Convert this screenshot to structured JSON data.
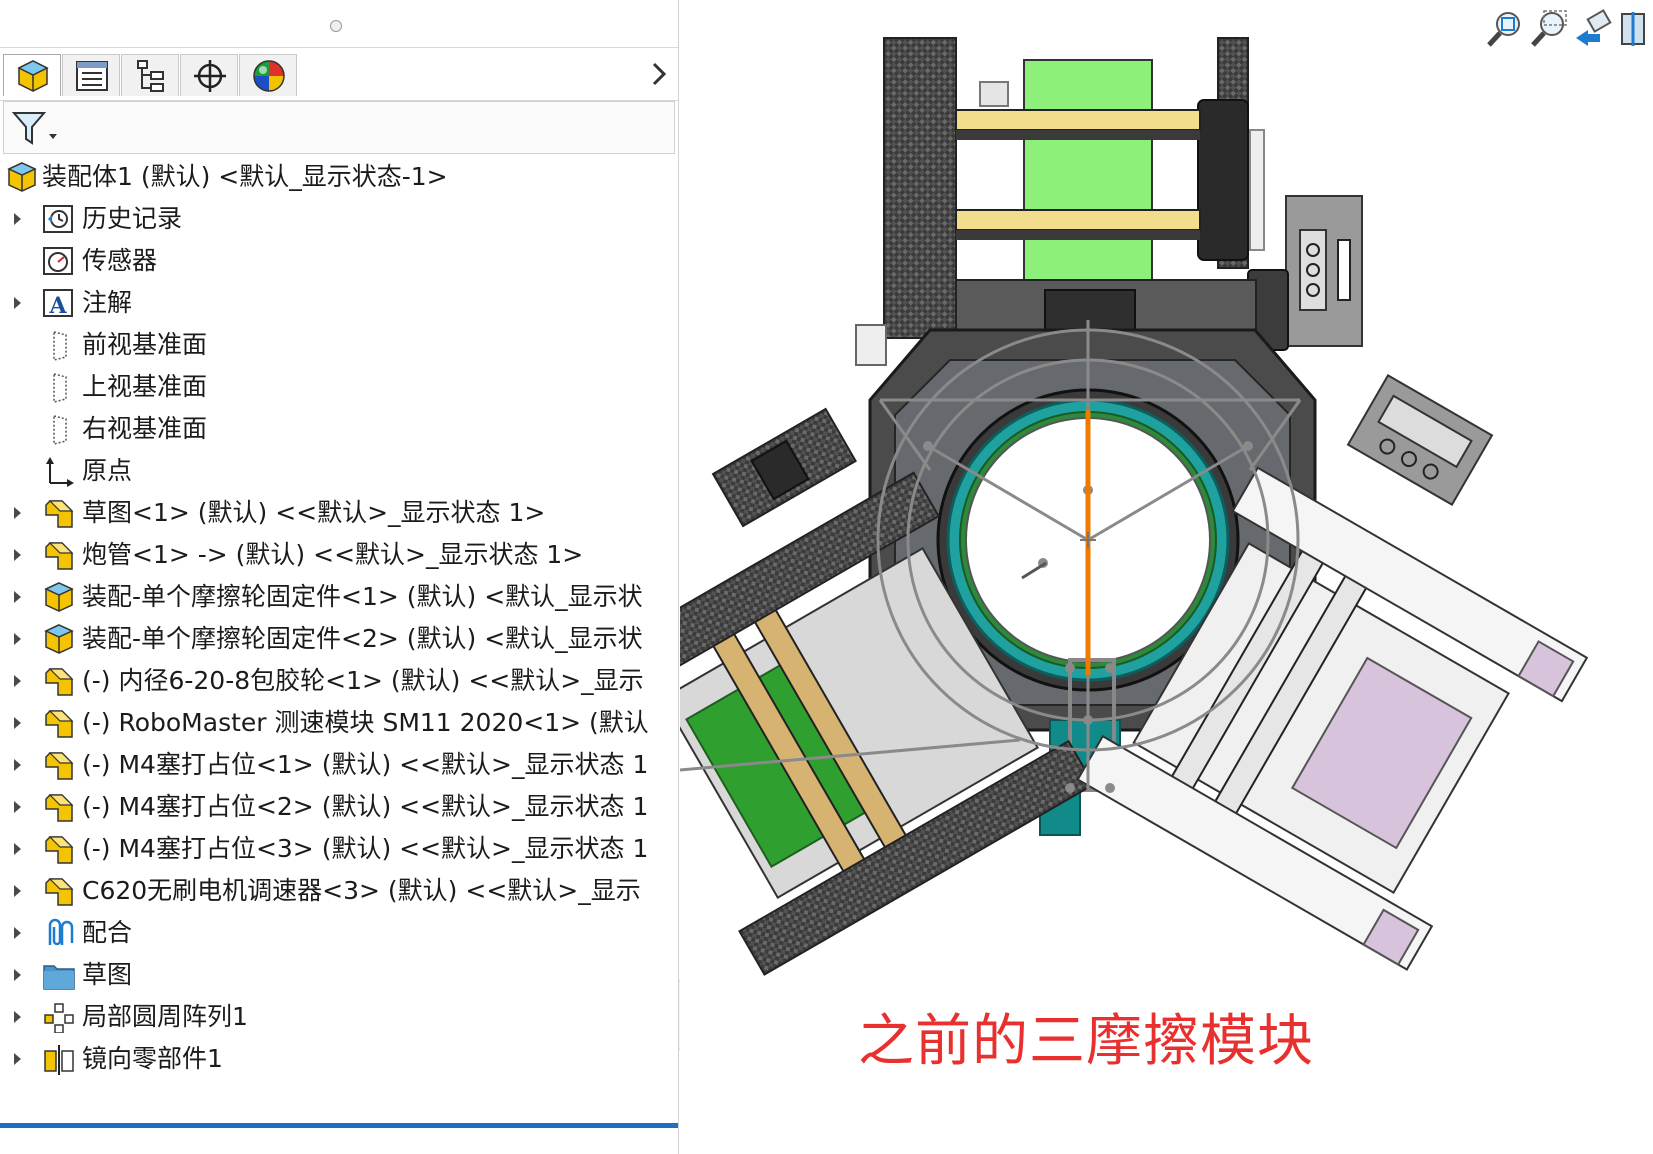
{
  "panel": {
    "tabs": [
      {
        "name": "feature-manager-tab",
        "icon": "assembly-cube-icon",
        "active": true
      },
      {
        "name": "property-manager-tab",
        "icon": "property-list-icon"
      },
      {
        "name": "configuration-manager-tab",
        "icon": "configuration-tree-icon"
      },
      {
        "name": "dimxpert-tab",
        "icon": "crosshair-target-icon"
      },
      {
        "name": "display-manager-tab",
        "icon": "color-sphere-icon"
      }
    ],
    "filter_icon": "funnel-filter-icon",
    "expand_icon": "chevron-right-icon"
  },
  "tree": {
    "root": {
      "label": "装配体1 (默认) <默认_显示状态-1>",
      "icon": "assembly-icon"
    },
    "items": [
      {
        "label": "历史记录",
        "icon": "history-icon",
        "expandable": true
      },
      {
        "label": "传感器",
        "icon": "sensor-gauge-icon",
        "expandable": false
      },
      {
        "label": "注解",
        "icon": "annotation-icon",
        "expandable": true
      },
      {
        "label": "前视基准面",
        "icon": "plane-icon",
        "expandable": false
      },
      {
        "label": "上视基准面",
        "icon": "plane-icon",
        "expandable": false
      },
      {
        "label": "右视基准面",
        "icon": "plane-icon",
        "expandable": false
      },
      {
        "label": "原点",
        "icon": "origin-icon",
        "expandable": false
      },
      {
        "label": "草图<1> (默认) <<默认>_显示状态 1>",
        "icon": "part-icon",
        "expandable": true
      },
      {
        "label": "炮管<1> -> (默认) <<默认>_显示状态 1>",
        "icon": "part-icon",
        "expandable": true
      },
      {
        "label": "装配-单个摩擦轮固定件<1> (默认) <默认_显示状",
        "icon": "subassembly-icon",
        "expandable": true
      },
      {
        "label": "装配-单个摩擦轮固定件<2> (默认) <默认_显示状",
        "icon": "subassembly-icon",
        "expandable": true
      },
      {
        "label": "(-) 内径6-20-8包胶轮<1> (默认) <<默认>_显示",
        "icon": "part-icon",
        "expandable": true
      },
      {
        "label": "(-) RoboMaster 测速模块 SM11 2020<1> (默认",
        "icon": "part-icon",
        "expandable": true
      },
      {
        "label": "(-) M4塞打占位<1> (默认) <<默认>_显示状态 1",
        "icon": "part-icon",
        "expandable": true
      },
      {
        "label": "(-) M4塞打占位<2> (默认) <<默认>_显示状态 1",
        "icon": "part-icon",
        "expandable": true
      },
      {
        "label": "(-) M4塞打占位<3> (默认) <<默认>_显示状态 1",
        "icon": "part-icon",
        "expandable": true
      },
      {
        "label": "C620无刷电机调速器<3> (默认) <<默认>_显示",
        "icon": "part-icon",
        "expandable": true
      },
      {
        "label": "配合",
        "icon": "mates-paperclip-icon",
        "expandable": true
      },
      {
        "label": "草图",
        "icon": "folder-icon",
        "expandable": true
      },
      {
        "label": "局部圆周阵列1",
        "icon": "circular-pattern-icon",
        "expandable": true
      },
      {
        "label": "镜向零部件1",
        "icon": "mirror-component-icon",
        "expandable": true
      }
    ]
  },
  "view_toolbar": [
    {
      "name": "zoom-to-fit-icon"
    },
    {
      "name": "zoom-to-area-icon"
    },
    {
      "name": "previous-view-icon"
    },
    {
      "name": "section-view-icon"
    }
  ],
  "caption": {
    "text": "之前的三摩擦模块",
    "color": "#e8312f"
  }
}
